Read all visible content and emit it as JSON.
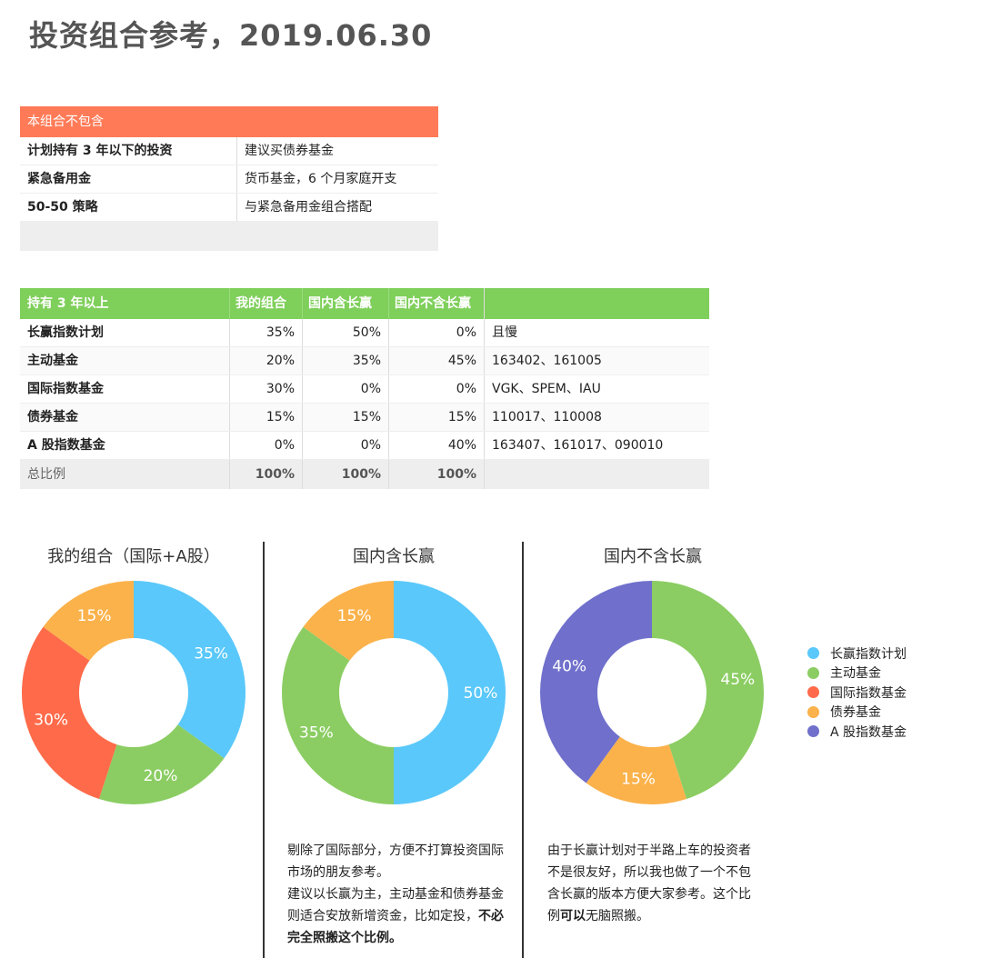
{
  "title": "投资组合参考，2019.06.30",
  "excluded_table": {
    "header": "本组合不包含",
    "rows": [
      {
        "item": "计划持有 3 年以下的投资",
        "note": "建议买债券基金"
      },
      {
        "item": "紧急备用金",
        "note": "货币基金，6 个月家庭开支"
      },
      {
        "item": "50-50 策略",
        "note": "与紧急备用金组合搭配"
      }
    ]
  },
  "holdings_table": {
    "headers": [
      "持有 3 年以上",
      "我的组合",
      "国内含长赢",
      "国内不含长赢",
      ""
    ],
    "rows": [
      {
        "name": "长赢指数计划",
        "mine": "35%",
        "domestic": "50%",
        "domestic_ex": "0%",
        "note": "且慢"
      },
      {
        "name": "主动基金",
        "mine": "20%",
        "domestic": "35%",
        "domestic_ex": "45%",
        "note": "163402、161005"
      },
      {
        "name": "国际指数基金",
        "mine": "30%",
        "domestic": "0%",
        "domestic_ex": "0%",
        "note": "VGK、SPEM、IAU"
      },
      {
        "name": "债券基金",
        "mine": "15%",
        "domestic": "15%",
        "domestic_ex": "15%",
        "note": "110017、110008"
      },
      {
        "name": "A 股指数基金",
        "mine": "0%",
        "domestic": "0%",
        "domestic_ex": "40%",
        "note": "163407、161017、090010"
      }
    ],
    "total": {
      "name": "总比例",
      "mine": "100%",
      "domestic": "100%",
      "domestic_ex": "100%"
    }
  },
  "colors": {
    "长赢指数计划": "#5ac8fa",
    "主动基金": "#8bcd63",
    "国际指数基金": "#ff6b4a",
    "债券基金": "#fbb24b",
    "A 股指数基金": "#7070cc"
  },
  "chart_data": [
    {
      "type": "pie",
      "title": "我的组合（国际+A股）",
      "categories": [
        "长赢指数计划",
        "主动基金",
        "国际指数基金",
        "债券基金"
      ],
      "values": [
        35,
        20,
        30,
        15
      ]
    },
    {
      "type": "pie",
      "title": "国内含长赢",
      "categories": [
        "长赢指数计划",
        "主动基金",
        "债券基金"
      ],
      "values": [
        50,
        35,
        15
      ]
    },
    {
      "type": "pie",
      "title": "国内不含长赢",
      "categories": [
        "主动基金",
        "债券基金",
        "A 股指数基金"
      ],
      "values": [
        45,
        15,
        40
      ]
    }
  ],
  "legend": [
    "长赢指数计划",
    "主动基金",
    "国际指数基金",
    "债券基金",
    "A 股指数基金"
  ],
  "notes": {
    "middle": [
      {
        "text": "剔除了国际部分，方便不打算投资国际市场的朋友参考。"
      },
      {
        "text": "建议以长赢为主，主动基金和债券基金则适合安放新增资金，比如定投，"
      },
      {
        "text": "不必完全照搬这个比例。",
        "bold": true
      }
    ],
    "right_plain": "由于长赢计划对于半路上车的投资者不是很友好，所以我也做了一个不包含长赢的版本方便大家参考。这个比例",
    "right_bold": "可以",
    "right_tail": "无脑照搬。"
  }
}
